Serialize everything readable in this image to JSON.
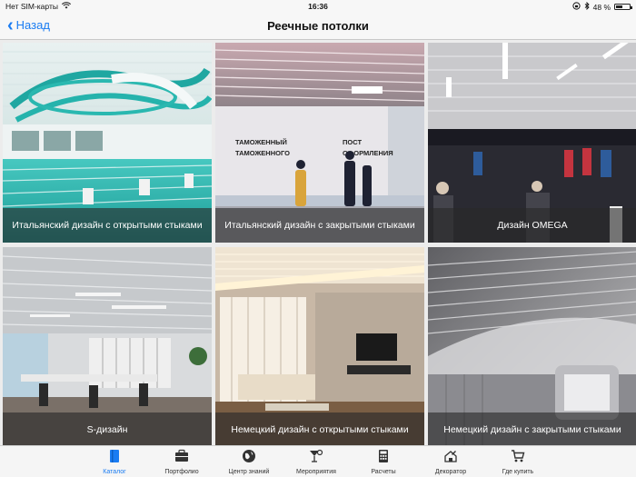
{
  "status_bar": {
    "carrier": "Нет SIM-карты",
    "time": "16:36",
    "battery_percent": "48 %"
  },
  "nav": {
    "back_label": "Назад",
    "title": "Реечные потолки"
  },
  "tiles": [
    {
      "caption": "Итальянский дизайн с открытыми стыками"
    },
    {
      "caption": "Итальянский дизайн с закрытыми стыками",
      "sign_lines": [
        "ТАМОЖЕННЫЙ",
        "ТАМОЖЕННОГО",
        "ПОСТ",
        "ОФОРМЛЕНИЯ"
      ]
    },
    {
      "caption": "Дизайн OMEGA"
    },
    {
      "caption": "S-дизайн"
    },
    {
      "caption": "Немецкий дизайн с открытыми стыками"
    },
    {
      "caption": "Немецкий дизайн с закрытыми стыками"
    }
  ],
  "tabs": [
    {
      "label": "Каталог",
      "icon": "book-icon",
      "active": true
    },
    {
      "label": "Портфолио",
      "icon": "briefcase-icon"
    },
    {
      "label": "Центр знаний",
      "icon": "globe-icon"
    },
    {
      "label": "Мероприятия",
      "icon": "cocktail-icon"
    },
    {
      "label": "Расчеты",
      "icon": "calculator-icon"
    },
    {
      "label": "Декоратор",
      "icon": "decorator-icon"
    },
    {
      "label": "Где купить",
      "icon": "cart-icon"
    }
  ],
  "colors": {
    "accent": "#1a7cf2",
    "caption_bg": "rgba(40,40,40,0.62)"
  }
}
